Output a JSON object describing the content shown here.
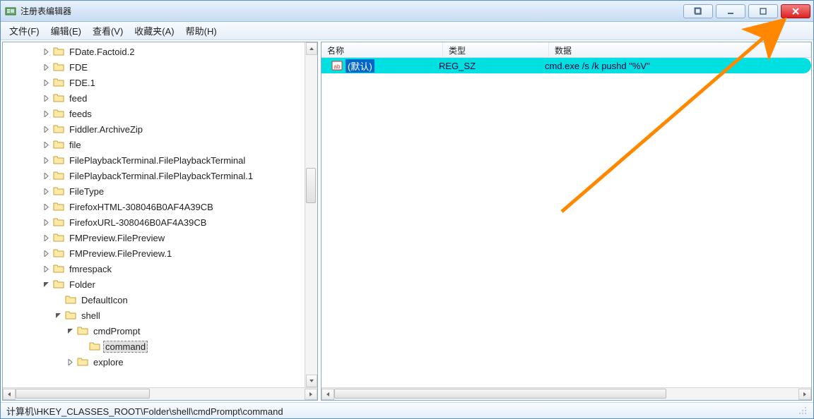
{
  "window": {
    "title": "注册表编辑器"
  },
  "menu": {
    "file": "文件(F)",
    "edit": "编辑(E)",
    "view": "查看(V)",
    "favorites": "收藏夹(A)",
    "help": "帮助(H)"
  },
  "tree": {
    "items": [
      {
        "indent": 3,
        "exp": "closed",
        "label": "FDate.Factoid.2"
      },
      {
        "indent": 3,
        "exp": "closed",
        "label": "FDE"
      },
      {
        "indent": 3,
        "exp": "closed",
        "label": "FDE.1"
      },
      {
        "indent": 3,
        "exp": "closed",
        "label": "feed"
      },
      {
        "indent": 3,
        "exp": "closed",
        "label": "feeds"
      },
      {
        "indent": 3,
        "exp": "closed",
        "label": "Fiddler.ArchiveZip"
      },
      {
        "indent": 3,
        "exp": "closed",
        "label": "file"
      },
      {
        "indent": 3,
        "exp": "closed",
        "label": "FilePlaybackTerminal.FilePlaybackTerminal"
      },
      {
        "indent": 3,
        "exp": "closed",
        "label": "FilePlaybackTerminal.FilePlaybackTerminal.1"
      },
      {
        "indent": 3,
        "exp": "closed",
        "label": "FileType"
      },
      {
        "indent": 3,
        "exp": "closed",
        "label": "FirefoxHTML-308046B0AF4A39CB"
      },
      {
        "indent": 3,
        "exp": "closed",
        "label": "FirefoxURL-308046B0AF4A39CB"
      },
      {
        "indent": 3,
        "exp": "closed",
        "label": "FMPreview.FilePreview"
      },
      {
        "indent": 3,
        "exp": "closed",
        "label": "FMPreview.FilePreview.1"
      },
      {
        "indent": 3,
        "exp": "closed",
        "label": "fmrespack"
      },
      {
        "indent": 3,
        "exp": "open",
        "label": "Folder"
      },
      {
        "indent": 4,
        "exp": "none",
        "label": "DefaultIcon"
      },
      {
        "indent": 4,
        "exp": "open",
        "label": "shell"
      },
      {
        "indent": 5,
        "exp": "open",
        "label": "cmdPrompt"
      },
      {
        "indent": 6,
        "exp": "none",
        "label": "command",
        "selected": true
      },
      {
        "indent": 5,
        "exp": "closed",
        "label": "explore"
      }
    ]
  },
  "list": {
    "headers": {
      "name": "名称",
      "type": "类型",
      "data": "数据"
    },
    "rows": [
      {
        "name": "(默认)",
        "type": "REG_SZ",
        "data": "cmd.exe /s /k pushd \"%V\"",
        "selected": true
      }
    ]
  },
  "status": {
    "path": "计算机\\HKEY_CLASSES_ROOT\\Folder\\shell\\cmdPrompt\\command"
  }
}
